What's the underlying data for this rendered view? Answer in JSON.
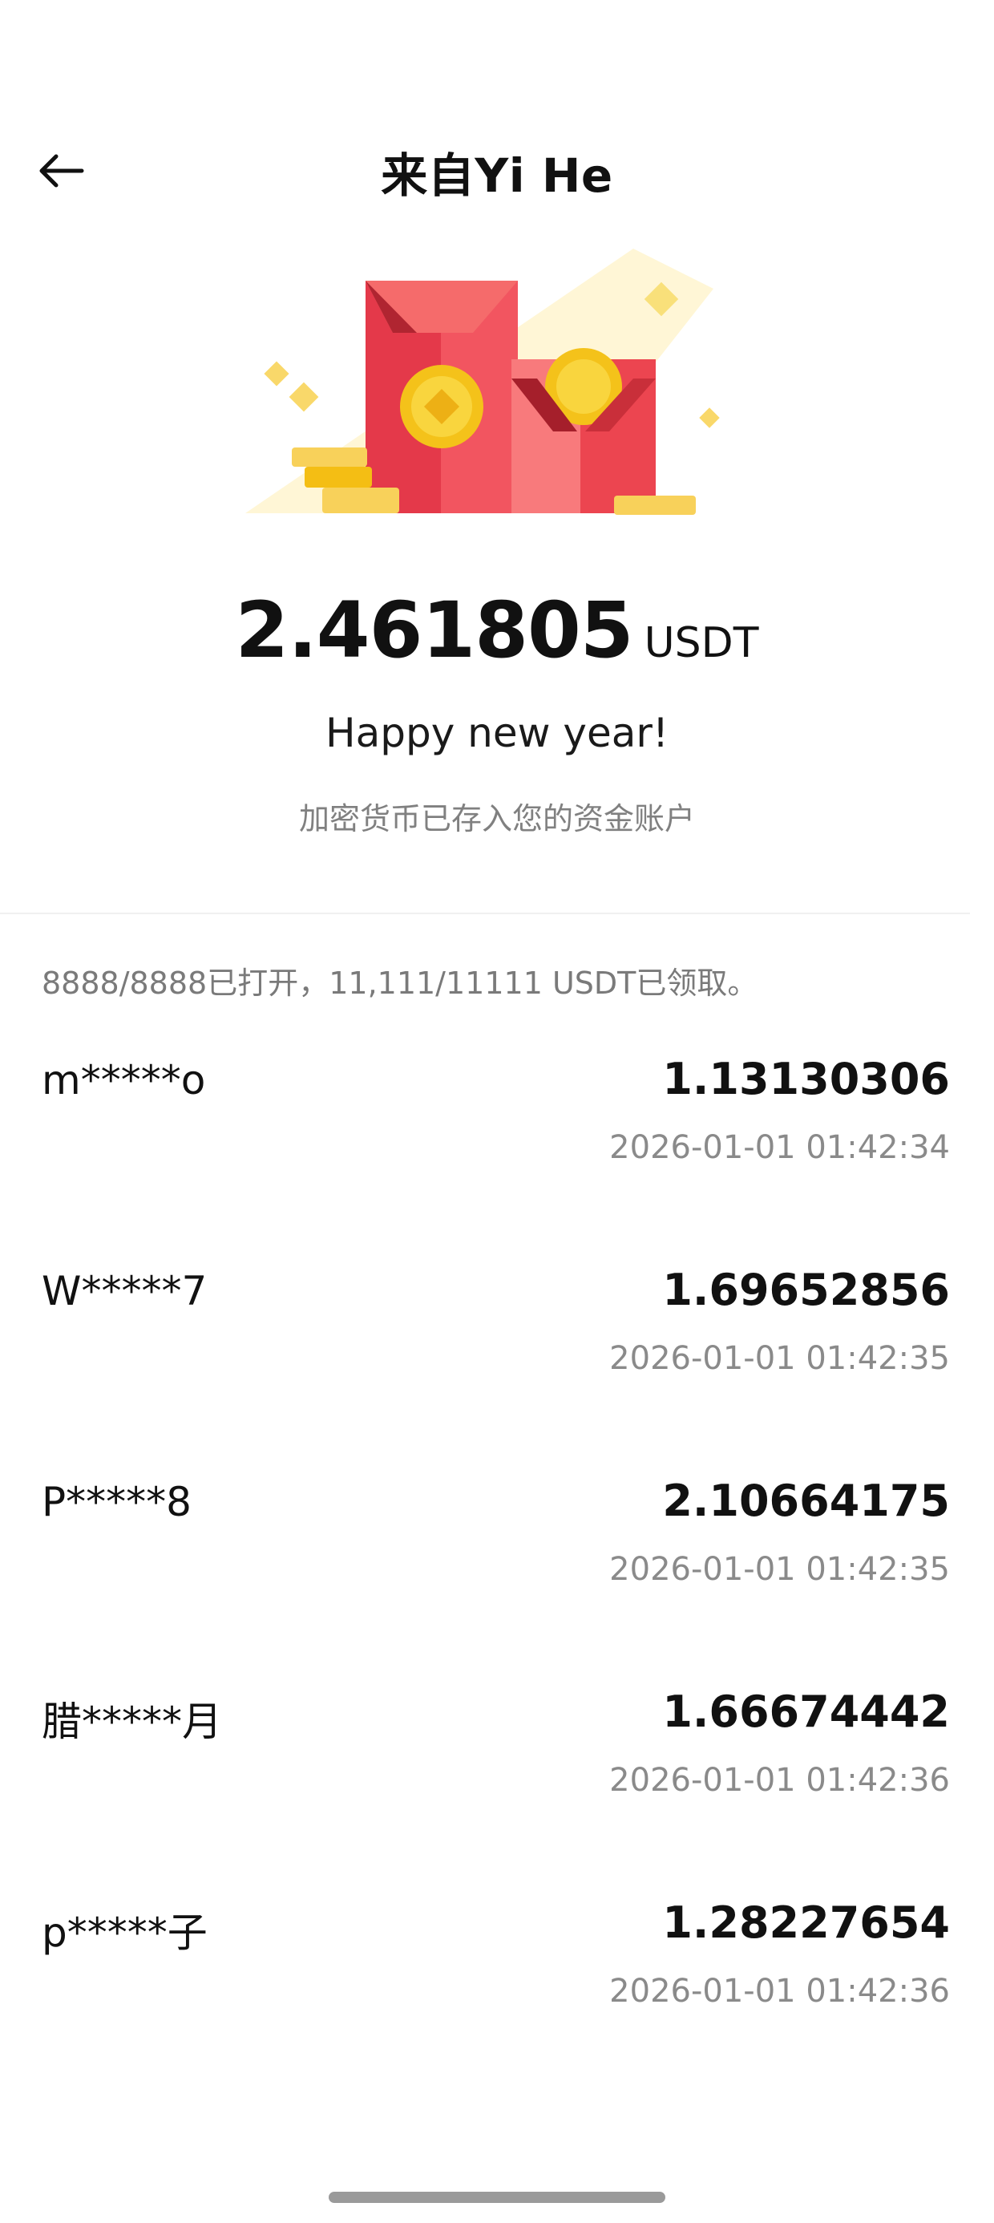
{
  "header": {
    "title": "来自Yi He",
    "back_icon": "arrow-left-icon"
  },
  "envelope": {
    "amount": "2.461805",
    "currency": "USDT",
    "message": "Happy new year!",
    "note": "加密货币已存入您的资金账户"
  },
  "summary": "8888/8888已打开，11,111/11111 USDT已领取。",
  "claims": [
    {
      "name": "m*****o",
      "amount": "1.13130306",
      "time": "2026-01-01 01:42:34"
    },
    {
      "name": "W*****7",
      "amount": "1.69652856",
      "time": "2026-01-01 01:42:35"
    },
    {
      "name": "P*****8",
      "amount": "2.10664175",
      "time": "2026-01-01 01:42:35"
    },
    {
      "name": "腊*****月",
      "amount": "1.66674442",
      "time": "2026-01-01 01:42:36"
    },
    {
      "name": "p*****子",
      "amount": "1.28227654",
      "time": "2026-01-01 01:42:36"
    }
  ],
  "colors": {
    "envelope_red": "#E8404A",
    "envelope_dark": "#C42A36",
    "coin_yellow": "#F7C718",
    "text_secondary": "#808080"
  }
}
